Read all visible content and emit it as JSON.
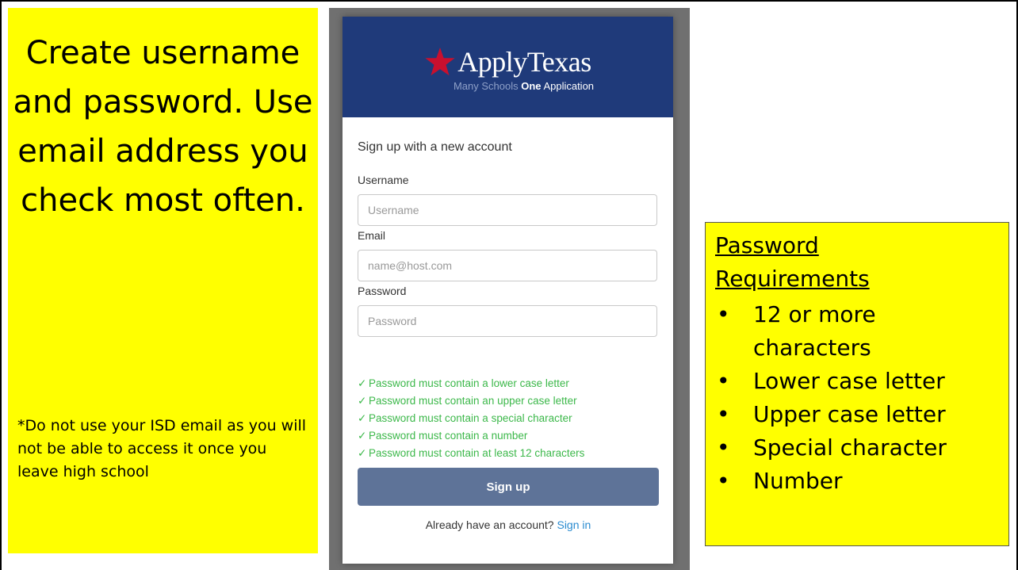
{
  "left_panel": {
    "title": "Create username and password. Use email address you check most often.",
    "note": "*Do not use your ISD email as you will not be able to access it once you leave high school"
  },
  "form": {
    "brand_name": "ApplyTexas",
    "tagline_muted": "Many Schools",
    "tagline_bold": "One",
    "tagline_rest": "Application",
    "heading": "Sign up with a new account",
    "username_label": "Username",
    "username_placeholder": "Username",
    "email_label": "Email",
    "email_placeholder": "name@host.com",
    "password_label": "Password",
    "password_placeholder": "Password",
    "requirements": [
      "Password must contain a lower case letter",
      "Password must contain an upper case letter",
      "Password must contain a special character",
      "Password must contain a number",
      "Password must contain at least 12 characters"
    ],
    "check_glyph": "✓",
    "signup_label": "Sign up",
    "signin_prompt": "Already have an account?",
    "signin_link": "Sign in"
  },
  "right_panel": {
    "title": "Password Requirements",
    "bullets": [
      "12 or more characters",
      "Lower case letter",
      "Upper case letter",
      "Special character",
      "Number"
    ]
  },
  "colors": {
    "highlight_yellow": "#ffff00",
    "header_blue": "#1f3a7a",
    "star_red": "#c8102e",
    "check_green": "#3cb84a",
    "button_slate": "#5e7398",
    "link_blue": "#2a8bd0"
  }
}
